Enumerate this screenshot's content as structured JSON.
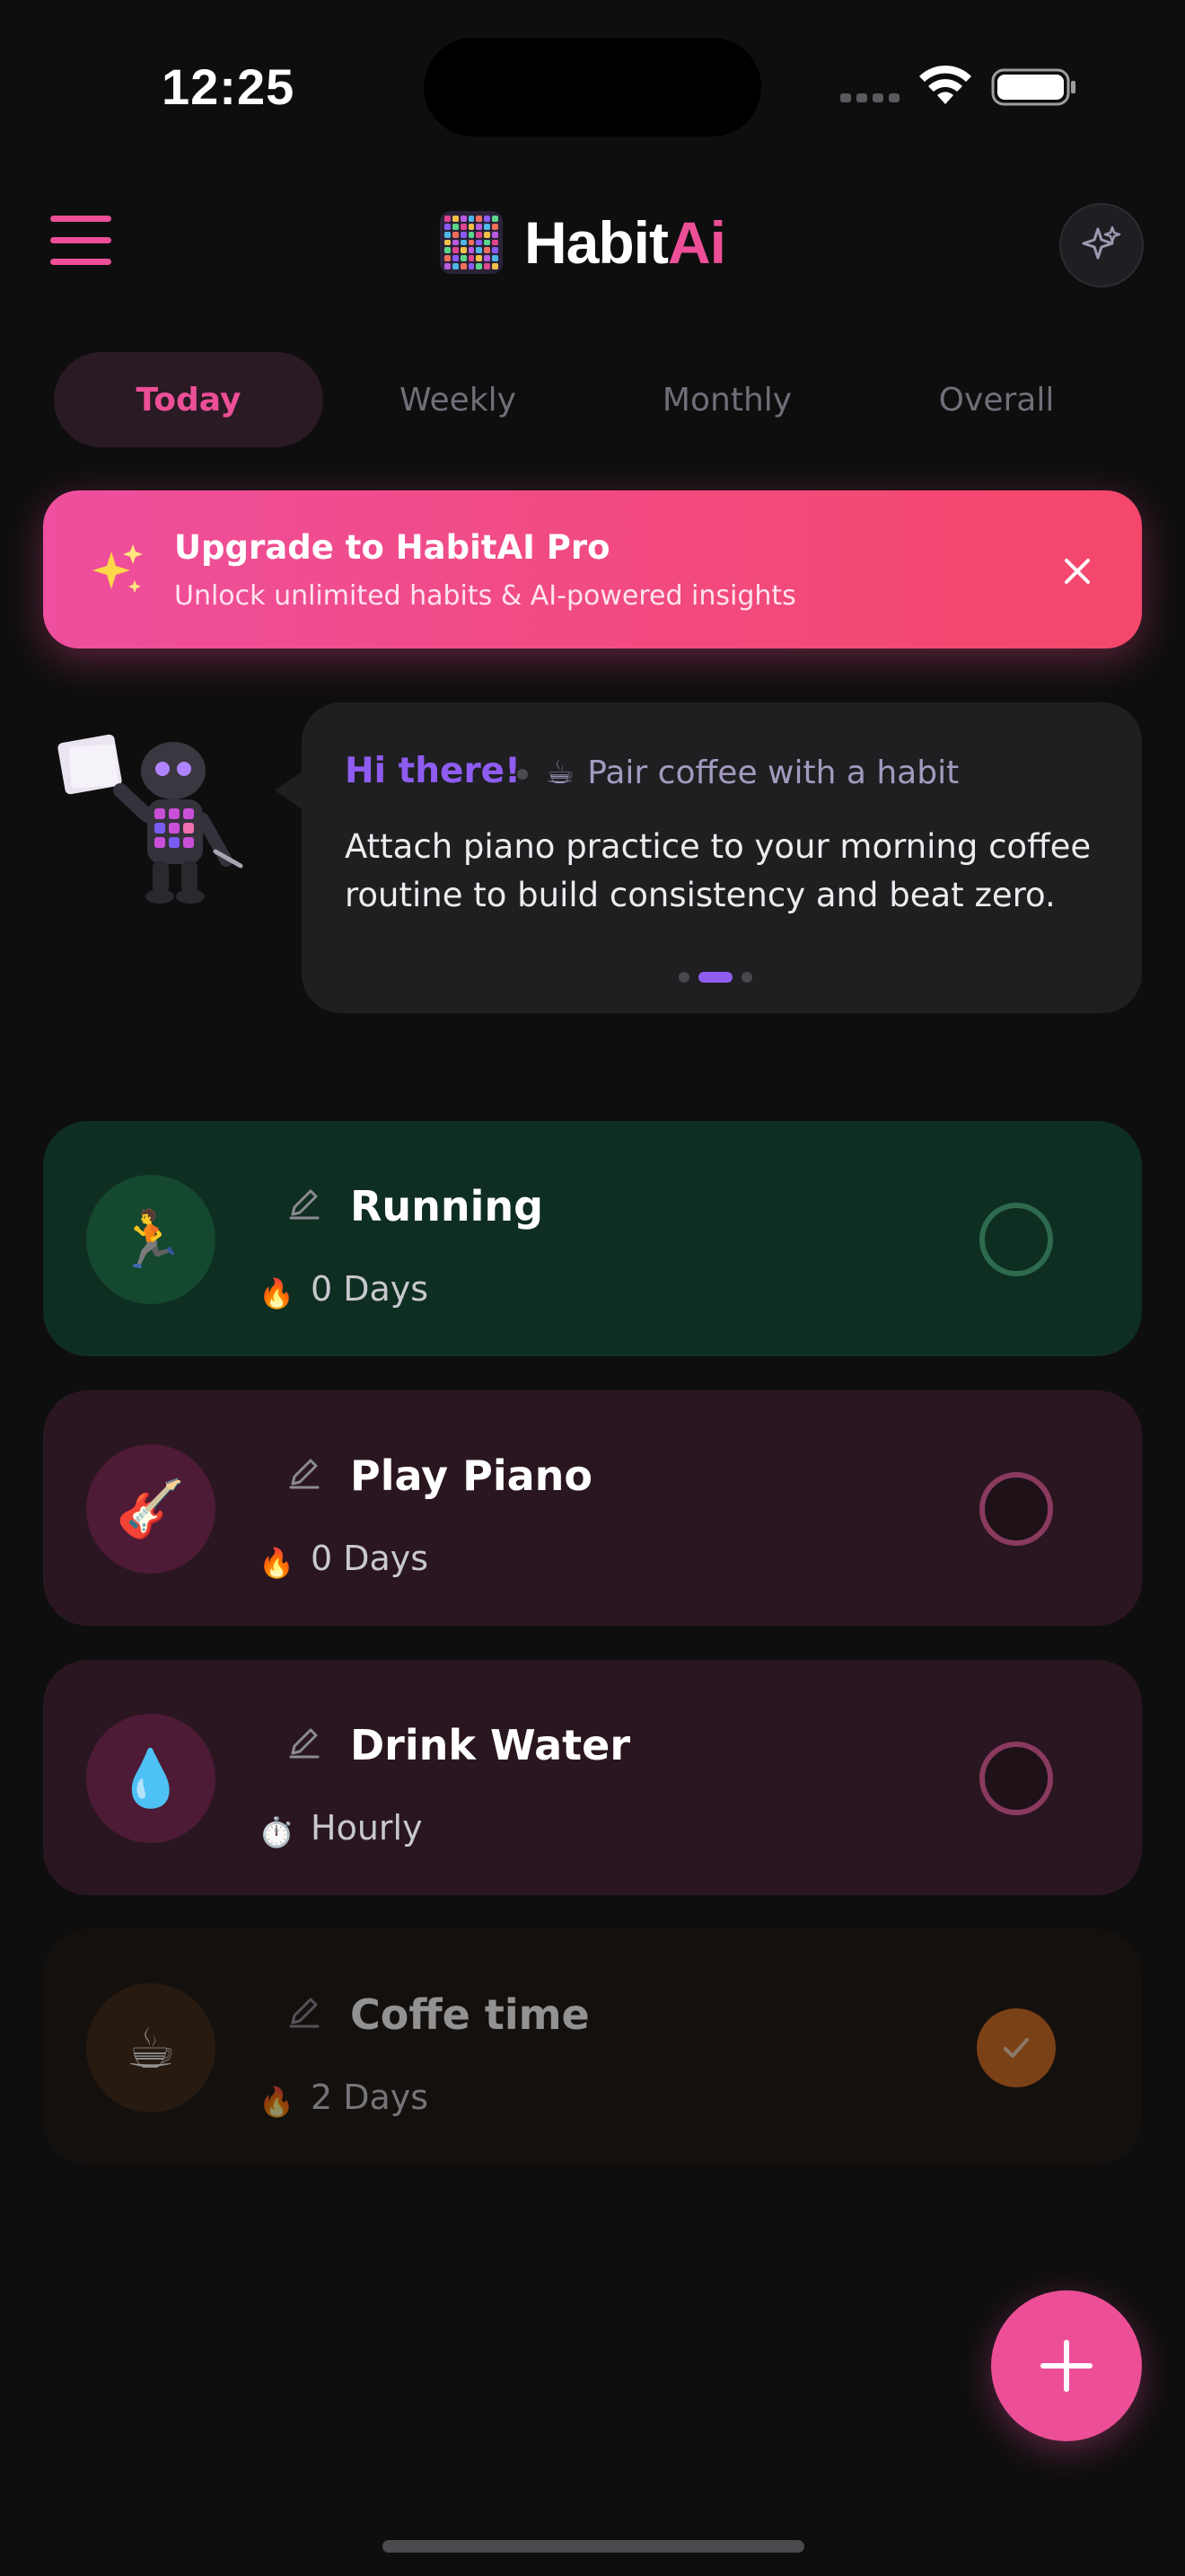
{
  "status_bar": {
    "time": "12:25"
  },
  "header": {
    "logo_text_main": "Habit",
    "logo_text_accent": "Ai",
    "menu_icon": "hamburger-menu-icon",
    "action_icon": "sparkles-icon"
  },
  "tabs": [
    {
      "label": "Today",
      "active": true
    },
    {
      "label": "Weekly",
      "active": false
    },
    {
      "label": "Monthly",
      "active": false
    },
    {
      "label": "Overall",
      "active": false
    }
  ],
  "upgrade_banner": {
    "title": "Upgrade to HabitAI Pro",
    "subtitle": "Unlock unlimited habits & AI-powered insights",
    "icon": "sparkles-emoji",
    "close_icon": "close-icon"
  },
  "assistant_tip": {
    "greeting": "Hi there!",
    "topic_icon": "☕",
    "topic": "Pair coffee with a habit",
    "body": "Attach piano practice to your morning coffee routine to build consistency and beat zero.",
    "page_count": 3,
    "current_page": 2
  },
  "habits": [
    {
      "name": "Running",
      "icon": "🏃",
      "meta_icon": "🔥",
      "meta": "0 Days",
      "completed": false,
      "accent": "#2e6a4e"
    },
    {
      "name": "Play Piano",
      "icon": "🎸",
      "meta_icon": "🔥",
      "meta": "0 Days",
      "completed": false,
      "accent": "#8a3a5e"
    },
    {
      "name": "Drink Water",
      "icon": "💧",
      "meta_icon": "⏱️",
      "meta": "Hourly",
      "completed": false,
      "accent": "#8a3a5e"
    },
    {
      "name": "Coffe time",
      "icon": "☕",
      "meta_icon": "🔥",
      "meta": "2 Days",
      "completed": true,
      "accent": "#d46b1d"
    }
  ],
  "fab": {
    "icon": "plus-icon"
  },
  "colors": {
    "brand_pink": "#ec4f97",
    "assistant_purple": "#8f5cf2",
    "background": "#0e0e0f"
  }
}
